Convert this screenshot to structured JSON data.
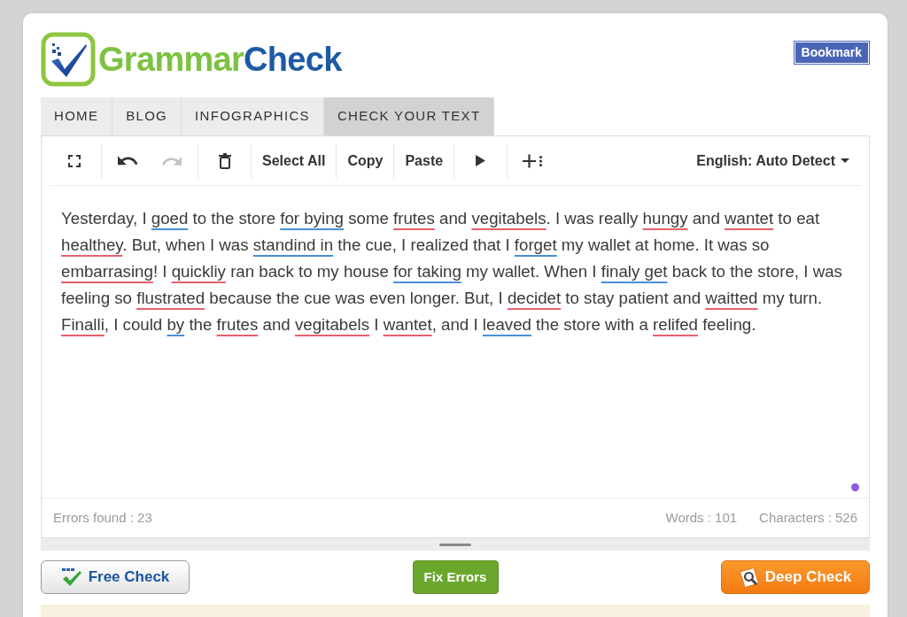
{
  "logo": {
    "parts": [
      "Grammar",
      "Check"
    ]
  },
  "bookmark_button": "Bookmark",
  "nav": {
    "tabs": [
      {
        "label": "HOME",
        "selected": false
      },
      {
        "label": "BLOG",
        "selected": false
      },
      {
        "label": "INFOGRAPHICS",
        "selected": false
      },
      {
        "label": "CHECK YOUR TEXT",
        "selected": true
      }
    ]
  },
  "editor": {
    "toolbar": {
      "history_buttons": [
        {
          "disabled": false
        },
        {
          "disabled": true
        }
      ],
      "text_buttons": [
        "Select All",
        "Copy",
        "Paste"
      ],
      "language": "English: Auto Detect"
    },
    "text": [
      {
        "text": "Yesterday, I ",
        "kind": "plain"
      },
      {
        "text": "goed",
        "kind": "grammar"
      },
      {
        "text": " to the store ",
        "kind": "plain"
      },
      {
        "text": "for bying",
        "kind": "grammar"
      },
      {
        "text": " some ",
        "kind": "plain"
      },
      {
        "text": "frutes",
        "kind": "spelling"
      },
      {
        "text": " and ",
        "kind": "plain"
      },
      {
        "text": "vegitabels",
        "kind": "spelling"
      },
      {
        "text": ". I was really ",
        "kind": "plain"
      },
      {
        "text": "hungy",
        "kind": "spelling"
      },
      {
        "text": " and ",
        "kind": "plain"
      },
      {
        "text": "wantet",
        "kind": "spelling"
      },
      {
        "text": " to eat ",
        "kind": "plain"
      },
      {
        "text": "healthey",
        "kind": "spelling"
      },
      {
        "text": ". But, when I was ",
        "kind": "plain"
      },
      {
        "text": "standind in",
        "kind": "grammar"
      },
      {
        "text": " the cue, I realized that I ",
        "kind": "plain"
      },
      {
        "text": "forget",
        "kind": "grammar"
      },
      {
        "text": " my wallet at home. It was so ",
        "kind": "plain"
      },
      {
        "text": "embarrasing",
        "kind": "spelling"
      },
      {
        "text": "! I ",
        "kind": "plain"
      },
      {
        "text": "quickliy",
        "kind": "spelling"
      },
      {
        "text": " ran back to my house ",
        "kind": "plain"
      },
      {
        "text": "for taking",
        "kind": "grammar"
      },
      {
        "text": " my wallet. When I ",
        "kind": "plain"
      },
      {
        "text": "finaly get",
        "kind": "grammar"
      },
      {
        "text": " back to the store, I was feeling so ",
        "kind": "plain"
      },
      {
        "text": "flustrated",
        "kind": "spelling"
      },
      {
        "text": " because the cue was even longer. But, I ",
        "kind": "plain"
      },
      {
        "text": "decidet",
        "kind": "spelling"
      },
      {
        "text": " to stay patient and ",
        "kind": "plain"
      },
      {
        "text": "waitted",
        "kind": "spelling"
      },
      {
        "text": " my turn. ",
        "kind": "plain"
      },
      {
        "text": "Finalli",
        "kind": "spelling"
      },
      {
        "text": ", I could ",
        "kind": "plain"
      },
      {
        "text": "by",
        "kind": "grammar"
      },
      {
        "text": " the ",
        "kind": "plain"
      },
      {
        "text": "frutes",
        "kind": "spelling"
      },
      {
        "text": " and ",
        "kind": "plain"
      },
      {
        "text": "vegitabels",
        "kind": "spelling"
      },
      {
        "text": " I ",
        "kind": "plain"
      },
      {
        "text": "wantet",
        "kind": "spelling"
      },
      {
        "text": ", and I ",
        "kind": "plain"
      },
      {
        "text": "leaved",
        "kind": "grammar"
      },
      {
        "text": " the store with a ",
        "kind": "plain"
      },
      {
        "text": "relifed",
        "kind": "spelling"
      },
      {
        "text": " feeling.",
        "kind": "plain"
      }
    ],
    "status": {
      "errors_found": "Errors found : 23",
      "words": "Words : 101",
      "characters": "Characters : 526"
    }
  },
  "actions": [
    {
      "label": "Free Check",
      "kind": "secondary"
    },
    {
      "label": "Fix Errors",
      "kind": "success"
    },
    {
      "label": "Deep Check",
      "kind": "warning"
    }
  ]
}
